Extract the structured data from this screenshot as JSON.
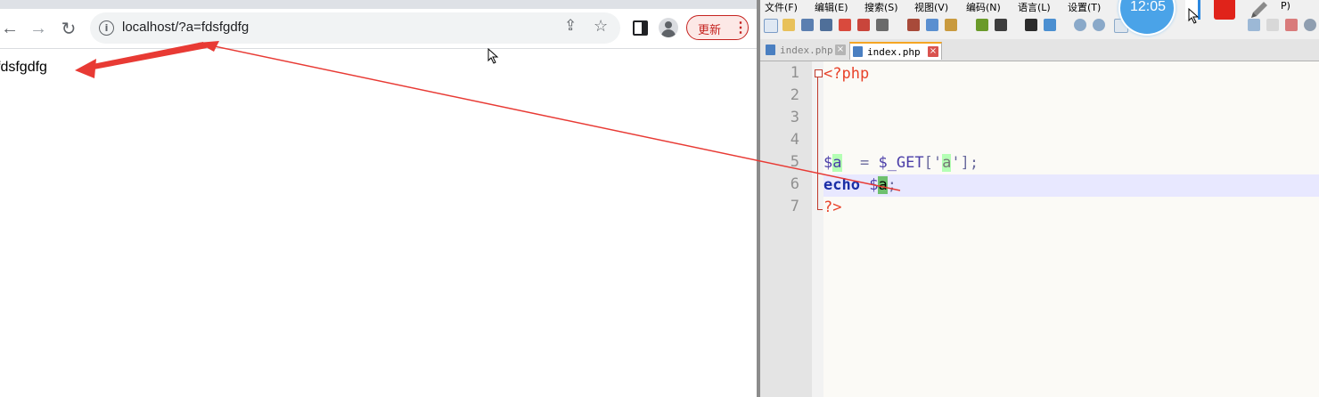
{
  "browser": {
    "address_url": "localhost/?a=fdsfgdfg",
    "page_output": "fdsfgdfg",
    "update_button_label": "更新",
    "back_glyph": "←",
    "forward_glyph": "→",
    "reload_glyph": "↻",
    "info_glyph": "i",
    "menu_glyph": "⋮",
    "share_glyph": "⇪",
    "star_glyph": "☆",
    "icons": [
      "back-icon",
      "forward-icon",
      "reload-icon",
      "info-icon",
      "share-icon",
      "star-icon",
      "side-panel-icon",
      "avatar",
      "menu-icon"
    ]
  },
  "editor": {
    "menu": [
      "文件(F)",
      "编辑(E)",
      "搜索(S)",
      "视图(V)",
      "编码(N)",
      "语言(L)",
      "设置(T)"
    ],
    "menu_tail": "P)",
    "tabs": [
      {
        "label": "index.php",
        "active": false
      },
      {
        "label": "index.php",
        "active": true
      }
    ],
    "tab_close_glyph": "×",
    "line_numbers": [
      "1",
      "2",
      "3",
      "4",
      "5",
      "6",
      "7"
    ],
    "code": {
      "line1_open_tag": "<?php",
      "line5_var": "$",
      "line5_var_name": "a",
      "line5_assign": "  = ",
      "line5_get": "$_GET",
      "line5_bracket_open": "['",
      "line5_key": "a",
      "line5_bracket_close": "'];",
      "line6_keyword": "echo",
      "line6_var": "$",
      "line6_var_name": "a",
      "line6_end": ";",
      "line7_close_tag": "?>"
    }
  },
  "overlay": {
    "clock_time": "12:05"
  },
  "colors": {
    "arrow": "#e83a34",
    "update_border": "#c5221f",
    "current_line": "#e8e8ff",
    "clock_bg": "#4aa3e8",
    "red_block": "#e0231a"
  }
}
